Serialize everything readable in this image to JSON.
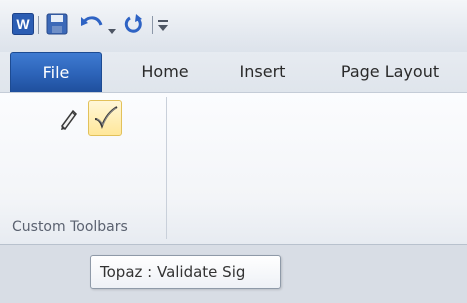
{
  "quick_access": {
    "app_icon": "word-icon",
    "save_icon": "save-icon",
    "undo_icon": "undo-icon",
    "redo_icon": "redo-icon",
    "customize_icon": "customize-qat-icon"
  },
  "tabs": [
    {
      "label": "File"
    },
    {
      "label": "Home"
    },
    {
      "label": "Insert"
    },
    {
      "label": "Page Layout"
    }
  ],
  "ribbon": {
    "group_label": "Custom Toolbars",
    "buttons": [
      "pencil-icon",
      "checkmark-icon"
    ]
  },
  "tooltip": {
    "text": "Topaz : Validate Sig"
  },
  "colors": {
    "file_tab": "#2c63b8",
    "highlight": "#ffe79a"
  }
}
